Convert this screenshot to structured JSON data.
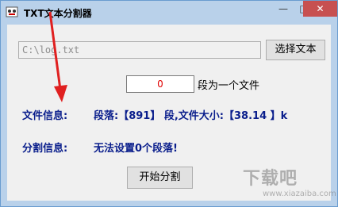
{
  "window": {
    "title": "TXT文本分割器",
    "minimize_label": "—",
    "maximize_label": "□",
    "close_label": "✕"
  },
  "file": {
    "path_value": "C:\\log.txt",
    "select_button_label": "选择文本"
  },
  "segment": {
    "count_value": "0",
    "suffix_label": "段为一个文件"
  },
  "file_info": {
    "label": "文件信息:",
    "value": "段落:【891】 段,文件大小:【38.14 】k"
  },
  "split_info": {
    "label": "分割信息:",
    "value": "无法设置0个段落!"
  },
  "start_button_label": "开始分割",
  "watermark": {
    "text": "下载吧",
    "url": "www.xiazaiba.com"
  },
  "colors": {
    "titlebar": "#b9d1ea",
    "client_bg": "#f0f0f0",
    "info_text": "#0a1e8c",
    "count_text": "#e00000",
    "annotation_arrow": "#e02020",
    "close_button": "#c75050"
  }
}
